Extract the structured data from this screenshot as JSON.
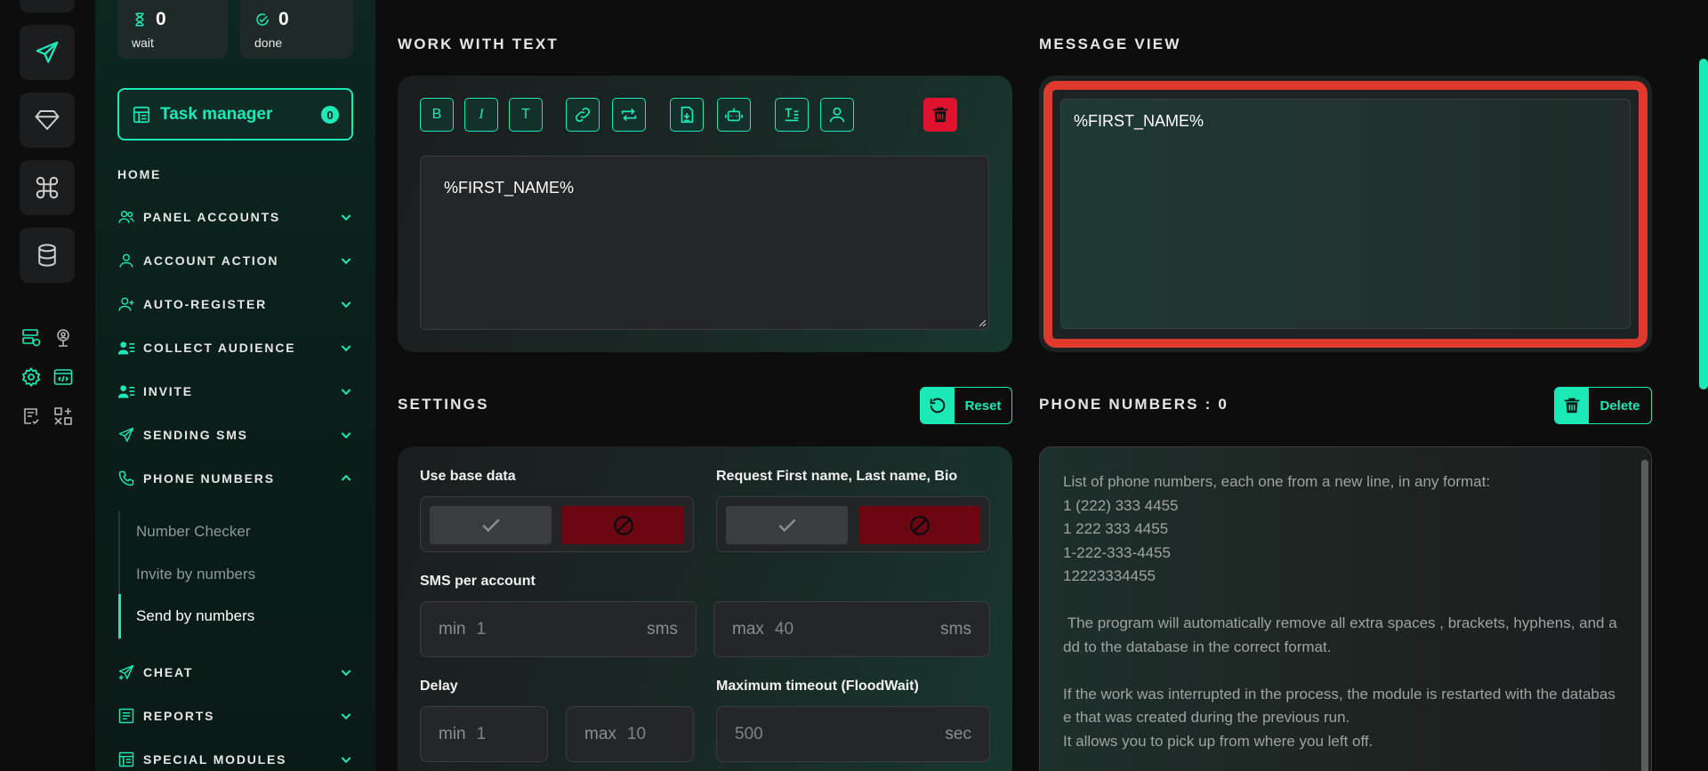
{
  "stats": {
    "wait": {
      "value": "0",
      "label": "wait"
    },
    "done": {
      "value": "0",
      "label": "done"
    }
  },
  "task_manager": {
    "label": "Task manager",
    "count": "0"
  },
  "nav": {
    "home": "HOME",
    "items": [
      {
        "label": "PANEL ACCOUNTS",
        "icon": "users-icon"
      },
      {
        "label": "ACCOUNT ACTION",
        "icon": "user-icon"
      },
      {
        "label": "AUTO-REGISTER",
        "icon": "user-plus-icon"
      },
      {
        "label": "COLLECT AUDIENCE",
        "icon": "user-list-icon"
      },
      {
        "label": "INVITE",
        "icon": "user-list-icon"
      },
      {
        "label": "SENDING SMS",
        "icon": "send-icon"
      },
      {
        "label": "PHONE NUMBERS",
        "icon": "phone-icon"
      },
      {
        "label": "CHEAT",
        "icon": "send-plus-icon"
      },
      {
        "label": "REPORTS",
        "icon": "report-icon"
      },
      {
        "label": "SPECIAL MODULES",
        "icon": "modules-icon"
      }
    ],
    "sub_items": [
      "Number Checker",
      "Invite by numbers",
      "Send by numbers"
    ]
  },
  "work_with_text": {
    "title": "WORK WITH TEXT",
    "toolbar": [
      "B",
      "I",
      "T"
    ],
    "editor_text": "%FIRST_NAME%"
  },
  "message_view": {
    "title": "MESSAGE VIEW",
    "text": "%FIRST_NAME%"
  },
  "settings": {
    "title": "SETTINGS",
    "reset_label": "Reset",
    "use_base_data": "Use base data",
    "request_names": "Request First name, Last name, Bio",
    "sms_per_account": "SMS per account",
    "sms_min": {
      "prefix": "min",
      "value": "1",
      "unit": "sms"
    },
    "sms_max": {
      "prefix": "max",
      "value": "40",
      "unit": "sms"
    },
    "delay": "Delay",
    "delay_min": {
      "prefix": "min",
      "value": "1"
    },
    "delay_max": {
      "prefix": "max",
      "value": "10"
    },
    "max_timeout": "Maximum timeout (FloodWait)",
    "timeout": {
      "value": "500",
      "unit": "sec"
    }
  },
  "phone_numbers": {
    "title": "PHONE NUMBERS : 0",
    "delete_label": "Delete",
    "placeholder": "List of phone numbers, each one from a new line, in any format:\n1 (222) 333 4455\n1 222 333 4455\n1-222-333-4455\n12223334455\n\n The program will automatically remove all extra spaces , brackets, hyphens, and add to the database in the correct format.\n\nIf the work was interrupted in the process, the module is restarted with the database that was created during the previous run.\nIt allows you to pick up from where you left off."
  },
  "colors": {
    "accent": "#1de9b6",
    "danger": "#e0132f",
    "highlight": "#e0392d"
  }
}
